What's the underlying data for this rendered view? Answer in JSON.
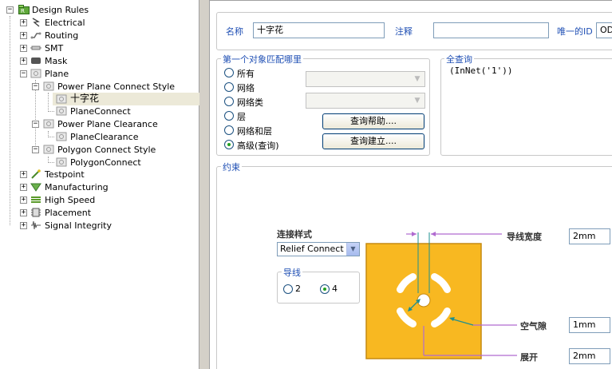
{
  "tree": {
    "root": "Design Rules",
    "items": {
      "electrical": "Electrical",
      "routing": "Routing",
      "smt": "SMT",
      "mask": "Mask",
      "plane": "Plane",
      "ppcs": "Power Plane Connect Style",
      "ppcs_child1": "十字花",
      "ppcs_child2": "PlaneConnect",
      "ppc": "Power Plane Clearance",
      "ppc_child1": "PlaneClearance",
      "pcs": "Polygon Connect Style",
      "pcs_child1": "PolygonConnect",
      "testpoint": "Testpoint",
      "manufacturing": "Manufacturing",
      "highspeed": "High Speed",
      "placement": "Placement",
      "signal": "Signal Integrity"
    }
  },
  "header": {
    "name_label": "名称",
    "name_value": "十字花",
    "comment_label": "注释",
    "comment_value": "",
    "uid_label": "唯一的ID",
    "uid_value": "OD"
  },
  "match": {
    "title": "第一个对象匹配哪里",
    "options": [
      "所有",
      "网络",
      "网络类",
      "层",
      "网络和层",
      "高级(查询)"
    ],
    "selected_index": 5,
    "query_help_button": "查询帮助....",
    "query_build_button": "查询建立...."
  },
  "full_query": {
    "title": "全查询",
    "text": "(InNet('1'))"
  },
  "constraints": {
    "title": "约束",
    "connect_style_label": "连接样式",
    "connect_style_value": "Relief Connect",
    "conductors_label": "导线",
    "conductor_options": [
      "2",
      "4"
    ],
    "conductor_selected": "4",
    "conductor_width_label": "导线宽度",
    "conductor_width_value": "2mm",
    "air_gap_label": "空气隙",
    "air_gap_value": "1mm",
    "expansion_label": "展开",
    "expansion_value": "2mm"
  },
  "colors": {
    "pad": "#f8b821",
    "accent_label": "#1f4fb4",
    "arrow": "#b06ad0"
  }
}
